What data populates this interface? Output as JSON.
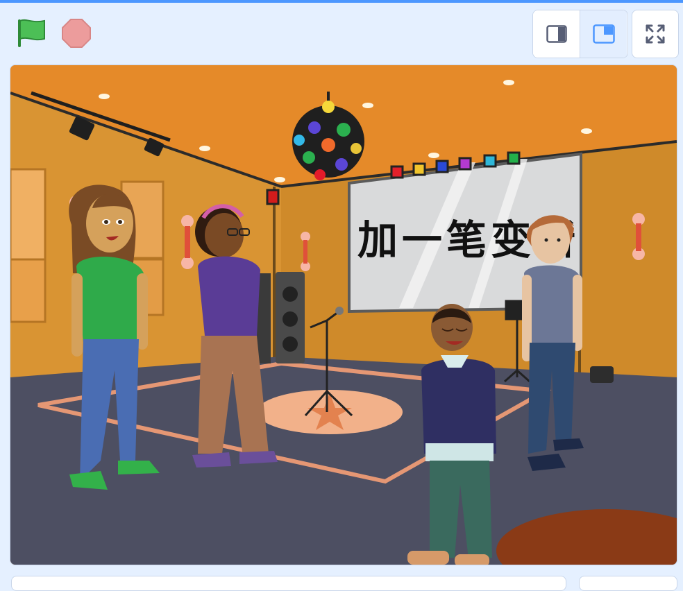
{
  "toolbar": {
    "green_flag": "green-flag-icon",
    "stop": "stop-icon",
    "small_stage": "small-stage-icon",
    "normal_stage": "normal-stage-icon",
    "fullscreen": "fullscreen-icon"
  },
  "stage": {
    "screen_text": "加一笔变新",
    "backdrop": "concert-stage",
    "sprites": [
      "girl-green-shirt",
      "girl-purple-shirt",
      "boy-navy-sweater",
      "boy-gray-shirt"
    ]
  },
  "colors": {
    "accent": "#4c97ff",
    "background": "#e5f0ff",
    "flag": "#4cbf56",
    "stop": "#ec9c9c"
  }
}
